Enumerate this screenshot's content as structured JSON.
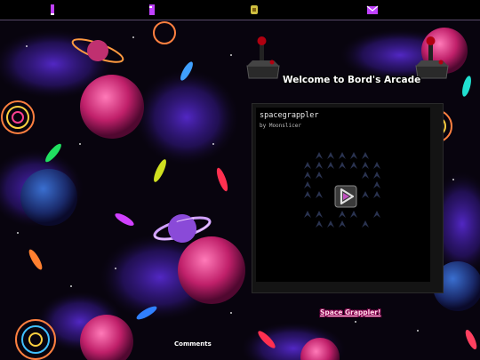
{
  "nav": {
    "icons": [
      {
        "name": "home-icon",
        "color": "#c040ff"
      },
      {
        "name": "games-icon",
        "color": "#c040ff"
      },
      {
        "name": "music-icon",
        "color": "#d0c040"
      },
      {
        "name": "mail-icon",
        "color": "#c040ff"
      }
    ]
  },
  "header": {
    "title": "Welcome to Bord's Arcade"
  },
  "game": {
    "title": "spacegrappler",
    "author": "by Moonslicer",
    "play_icon": "play-icon"
  },
  "links": {
    "game_link": "Space Grappler!",
    "comments": "Comments"
  },
  "colors": {
    "accent": "#c040ff",
    "link_text": "#ffd6e6",
    "panel_bg": "#141414"
  }
}
